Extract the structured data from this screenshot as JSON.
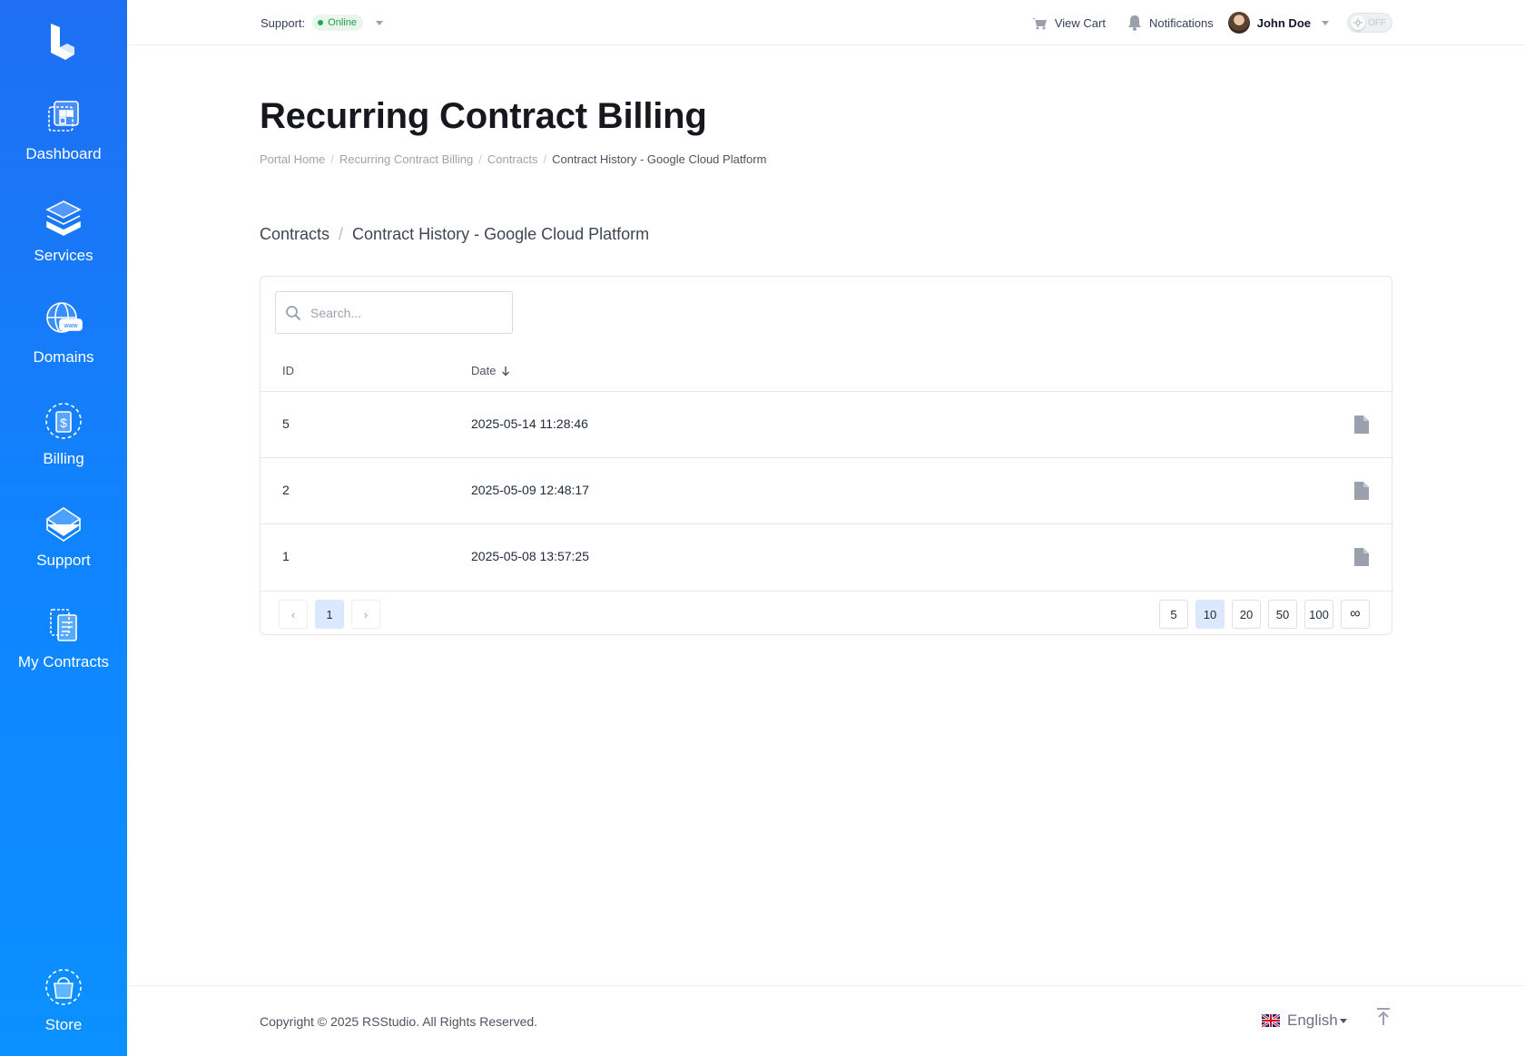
{
  "sidebar": {
    "items": [
      {
        "label": "Dashboard",
        "icon": "dashboard-icon"
      },
      {
        "label": "Services",
        "icon": "services-icon"
      },
      {
        "label": "Domains",
        "icon": "domains-icon"
      },
      {
        "label": "Billing",
        "icon": "billing-icon"
      },
      {
        "label": "Support",
        "icon": "support-icon"
      },
      {
        "label": "My Contracts",
        "icon": "contracts-icon"
      }
    ],
    "store": {
      "label": "Store",
      "icon": "store-icon"
    }
  },
  "topbar": {
    "support_label": "Support:",
    "support_status": "Online",
    "view_cart": "View Cart",
    "notifications": "Notifications",
    "user_name": "John Doe",
    "theme_toggle": "OFF"
  },
  "page": {
    "title": "Recurring Contract Billing",
    "breadcrumb": [
      "Portal Home",
      "Recurring Contract Billing",
      "Contracts",
      "Contract History - Google Cloud Platform"
    ],
    "section": {
      "parent": "Contracts",
      "current": "Contract History - Google Cloud Platform"
    }
  },
  "table": {
    "search_placeholder": "Search...",
    "columns": {
      "id": "ID",
      "date": "Date"
    },
    "rows": [
      {
        "id": "5",
        "date": "2025-05-14 11:28:46"
      },
      {
        "id": "2",
        "date": "2025-05-09 12:48:17"
      },
      {
        "id": "1",
        "date": "2025-05-08 13:57:25"
      }
    ],
    "pagination": {
      "prev": "‹",
      "current": "1",
      "next": "›"
    },
    "page_sizes": [
      "5",
      "10",
      "20",
      "50",
      "100",
      "∞"
    ],
    "active_page_size": "10"
  },
  "footer": {
    "copyright": "Copyright © 2025 RSStudio. All Rights Reserved.",
    "language": "English"
  },
  "colors": {
    "sidebar_top": "#1f6ff2",
    "sidebar_bottom": "#0b90ff",
    "online": "#22a852",
    "active_page": "#dbe8ff"
  }
}
